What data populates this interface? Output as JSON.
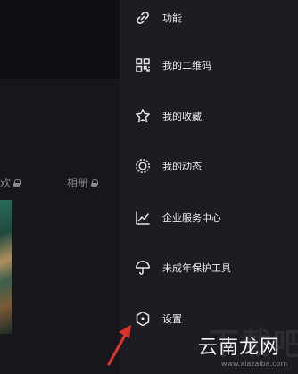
{
  "background": {
    "tabs": [
      {
        "label": "欢"
      },
      {
        "label": "相册"
      }
    ]
  },
  "drawer": {
    "items": [
      {
        "label": "功能",
        "icon": "link-icon"
      },
      {
        "label": "我的二维码",
        "icon": "qr-code-icon"
      },
      {
        "label": "我的收藏",
        "icon": "star-icon"
      },
      {
        "label": "我的动态",
        "icon": "activity-ring-icon"
      },
      {
        "label": "企业服务中心",
        "icon": "line-chart-icon"
      },
      {
        "label": "未成年保护工具",
        "icon": "umbrella-icon"
      },
      {
        "label": "设置",
        "icon": "settings-hexagon-icon"
      }
    ]
  },
  "watermark": {
    "ghost_text": "下载吧",
    "main_text": "云南龙网",
    "url": "www.xiazaiba.com"
  },
  "colors": {
    "drawer_bg": "#1d1c22",
    "page_bg": "#17161c",
    "arrow": "#d9342b",
    "text": "#ececee"
  }
}
